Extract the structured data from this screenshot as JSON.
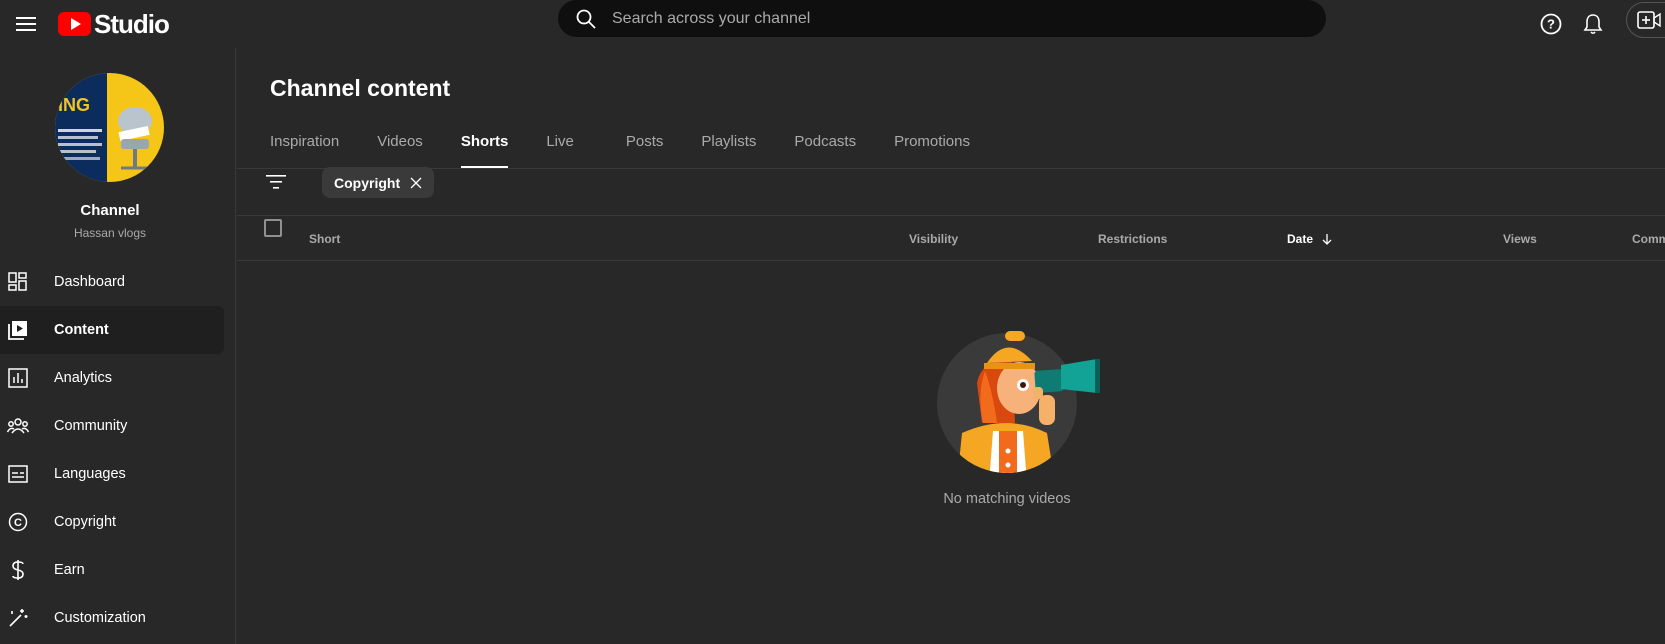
{
  "topbar": {
    "logo_text": "Studio",
    "search_placeholder": "Search across your channel"
  },
  "sidebar": {
    "channel_label": "Channel",
    "channel_name": "Hassan vlogs",
    "items": [
      {
        "label": "Dashboard",
        "icon": "dashboard-icon"
      },
      {
        "label": "Content",
        "icon": "content-icon",
        "active": true
      },
      {
        "label": "Analytics",
        "icon": "analytics-icon"
      },
      {
        "label": "Community",
        "icon": "community-icon"
      },
      {
        "label": "Languages",
        "icon": "languages-icon"
      },
      {
        "label": "Copyright",
        "icon": "copyright-icon"
      },
      {
        "label": "Earn",
        "icon": "earn-icon"
      },
      {
        "label": "Customization",
        "icon": "customization-icon"
      }
    ]
  },
  "main": {
    "title": "Channel content",
    "tabs": [
      {
        "label": "Inspiration"
      },
      {
        "label": "Videos"
      },
      {
        "label": "Shorts",
        "active": true
      },
      {
        "label": "Live"
      },
      {
        "label": "Posts"
      },
      {
        "label": "Playlists"
      },
      {
        "label": "Podcasts"
      },
      {
        "label": "Promotions"
      }
    ],
    "filter_chip": "Copyright",
    "columns": {
      "short": "Short",
      "visibility": "Visibility",
      "restrictions": "Restrictions",
      "date": "Date",
      "views": "Views",
      "comments": "Comm"
    },
    "empty_message": "No matching videos"
  },
  "colors": {
    "background": "#282828",
    "search_bg": "#0f0f0f",
    "brand_red": "#ff0000",
    "muted_text": "#aaaaaa"
  }
}
